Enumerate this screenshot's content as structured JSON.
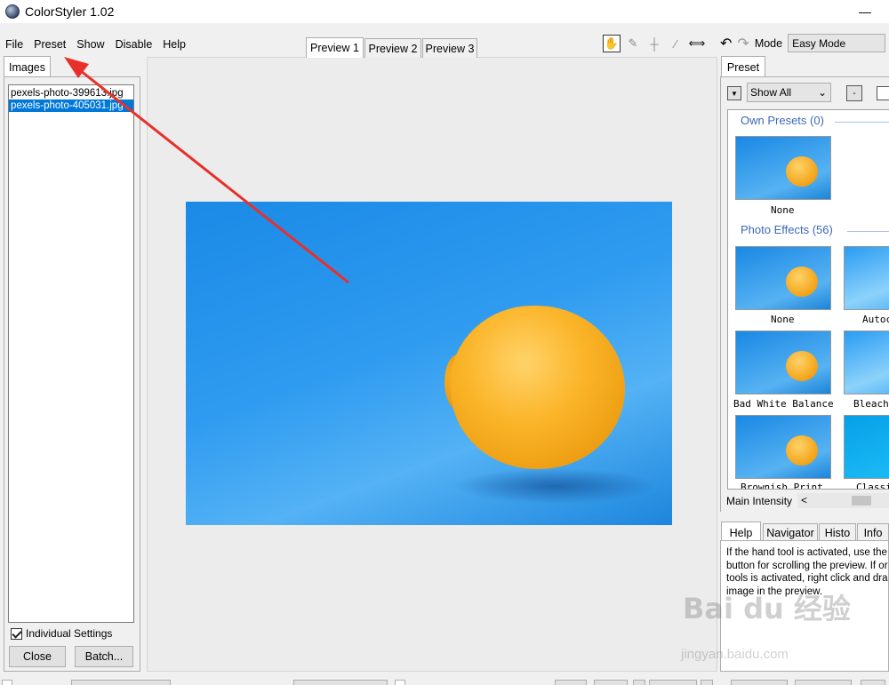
{
  "window": {
    "title": "ColorStyler 1.02",
    "minimize": "—"
  },
  "menu": {
    "items": [
      "File",
      "Preset",
      "Show",
      "Disable",
      "Help"
    ]
  },
  "left_panel": {
    "tab": "Images",
    "files": [
      "pexels-photo-399613.jpg",
      "pexels-photo-405031.jpg"
    ],
    "individual_settings_label": "Individual Settings",
    "close_label": "Close",
    "batch_label": "Batch..."
  },
  "preview": {
    "tabs": [
      "Preview 1",
      "Preview 2",
      "Preview 3"
    ]
  },
  "tools": {
    "hand": "✋",
    "eyedropper": "✎",
    "crosshair": "┼",
    "brush": "∕",
    "split": "⟺"
  },
  "mode": {
    "undo": "↶",
    "redo": "↷",
    "label": "Mode",
    "value": "Easy Mode",
    "arrow": "⌄"
  },
  "right_panel": {
    "tab": "Preset",
    "show_value": "Show All",
    "minus": "-",
    "own_presets_title": "Own Presets (0)",
    "photo_effects_title": "Photo Effects (56)",
    "own_presets": [
      {
        "label": "None"
      }
    ],
    "photo_effects": [
      {
        "label": "None"
      },
      {
        "label": "Autoc"
      },
      {
        "label": "Bad White Balance"
      },
      {
        "label": "Bleach"
      },
      {
        "label": "Brownish Print"
      },
      {
        "label": "Classi"
      }
    ]
  },
  "intensity": {
    "label": "Main Intensity",
    "left_arrow": "<"
  },
  "help_panel": {
    "tabs": [
      "Help",
      "Navigator",
      "Histo",
      "Info"
    ],
    "text": "If the hand tool is activated, use the\nbutton for scrolling the preview. If or\ntools is activated, right click and dra\nimage in the preview."
  },
  "watermark": {
    "main": "Bai du 经验",
    "sub": "jingyan.baidu.com"
  },
  "colors": {
    "accent": "#0078d7",
    "arrow": "#e8302a",
    "section": "#3c68b8"
  }
}
